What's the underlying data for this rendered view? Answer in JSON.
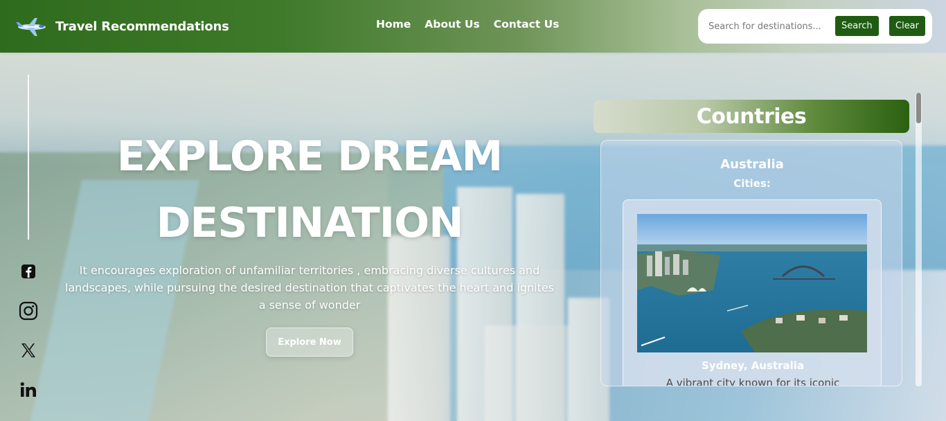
{
  "header": {
    "brand": "Travel Recommendations",
    "nav": [
      {
        "label": "Home"
      },
      {
        "label": "About Us"
      },
      {
        "label": "Contact Us"
      }
    ],
    "search": {
      "placeholder": "Search for destinations...",
      "value": "",
      "search_label": "Search",
      "clear_label": "Clear"
    }
  },
  "hero": {
    "title_line1": "EXPLORE DREAM",
    "title_line2": "DESTINATION",
    "text": "It encourages exploration of unfamiliar territories , embracing diverse cultures and landscapes, while pursuing the desired destination that captivates the heart and ignites a sense of wonder",
    "button_label": "Explore Now"
  },
  "social": [
    {
      "icon": "facebook-icon"
    },
    {
      "icon": "instagram-icon"
    },
    {
      "icon": "x-icon"
    },
    {
      "icon": "linkedin-icon"
    }
  ],
  "countries": {
    "heading": "Countries",
    "items": [
      {
        "name": "Australia",
        "cities_label": "Cities:",
        "cities": [
          {
            "name": "Sydney, Australia",
            "description": "A vibrant city known for its iconic"
          }
        ]
      }
    ]
  },
  "colors": {
    "brand_green": "#1f5c12",
    "header_start": "#2f6b1c",
    "text_white": "#ffffff"
  }
}
